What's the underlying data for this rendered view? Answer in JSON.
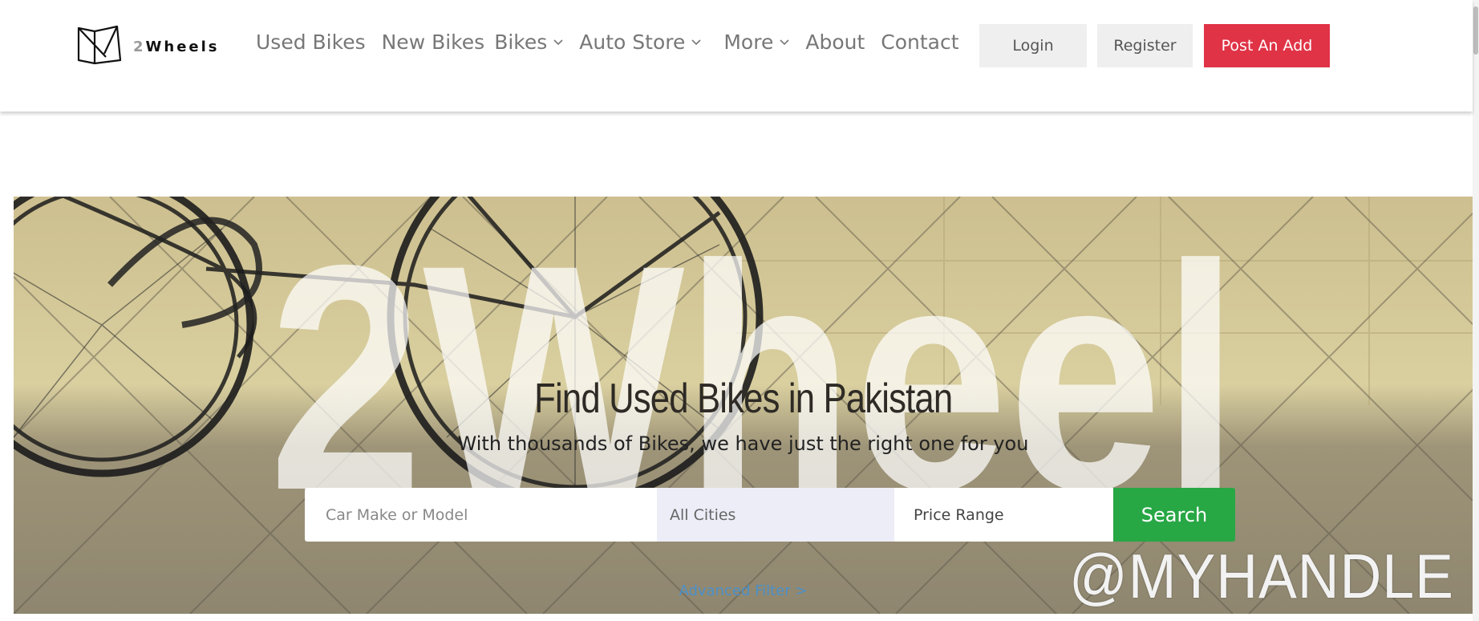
{
  "header": {
    "logo": {
      "icon": "2wheels-logo-icon",
      "prefix": "2",
      "name": "Wheels"
    },
    "nav": [
      {
        "label": "Used Bikes",
        "dropdown": false
      },
      {
        "label": "New Bikes",
        "dropdown": false
      },
      {
        "label": "Bikes",
        "dropdown": true
      },
      {
        "label": "Auto Store",
        "dropdown": true
      },
      {
        "label": "More",
        "dropdown": true
      },
      {
        "label": "About",
        "dropdown": false
      },
      {
        "label": "Contact",
        "dropdown": false
      }
    ],
    "buttons": {
      "login": "Login",
      "register": "Register",
      "post": "Post An Add"
    }
  },
  "hero": {
    "background_text": "2Wheel",
    "handle": "@MYHANDLE",
    "title": "Find Used Bikes in Pakistan",
    "subtitle": "With thousands of Bikes, we have just the right one for you",
    "search": {
      "model_placeholder": "Car Make or Model",
      "city_value": "All Cities",
      "price_value": "Price Range",
      "button": "Search"
    },
    "advanced_filter": "Advanced Filter >"
  },
  "colors": {
    "accent_red": "#e03346",
    "search_green": "#28a745",
    "link_blue": "#4a90c9"
  }
}
